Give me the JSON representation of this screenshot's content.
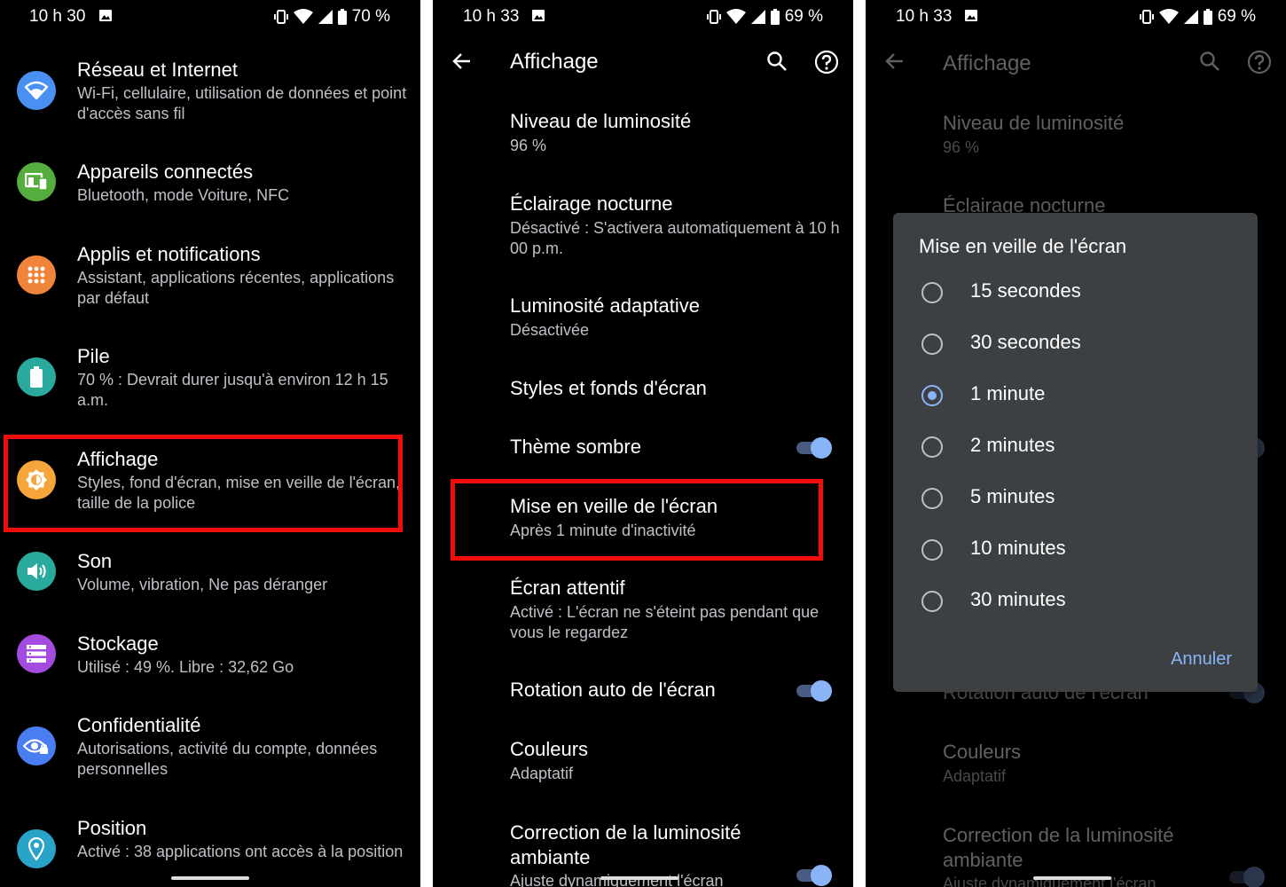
{
  "colors": {
    "highlight": "#f20d0d",
    "accent": "#8ab4f8",
    "dialog_bg": "#3c4043"
  },
  "screen1": {
    "status": {
      "time": "10 h 30",
      "battery": "70 %"
    },
    "items": [
      {
        "icon": "wifi-icon",
        "color": "#4a90f2",
        "title": "Réseau et Internet",
        "subtitle": "Wi-Fi, cellulaire, utilisation de données et point d'accès sans fil"
      },
      {
        "icon": "devices-icon",
        "color": "#55ad3e",
        "title": "Appareils connectés",
        "subtitle": "Bluetooth, mode Voiture, NFC"
      },
      {
        "icon": "apps-icon",
        "color": "#f0843b",
        "title": "Applis et notifications",
        "subtitle": "Assistant, applications récentes, applications par défaut"
      },
      {
        "icon": "battery-icon",
        "color": "#2aa99d",
        "title": "Pile",
        "subtitle": "70 % : Devrait durer jusqu'à environ 12 h 15 a.m."
      },
      {
        "icon": "brightness-icon",
        "color": "#f5a53a",
        "title": "Affichage",
        "subtitle": "Styles, fond d'écran, mise en veille de l'écran, taille de la police"
      },
      {
        "icon": "volume-icon",
        "color": "#2aa99d",
        "title": "Son",
        "subtitle": "Volume, vibration, Ne pas déranger"
      },
      {
        "icon": "storage-icon",
        "color": "#a54ce0",
        "title": "Stockage",
        "subtitle": "Utilisé : 49 %. Libre : 32,62 Go"
      },
      {
        "icon": "privacy-icon",
        "color": "#4a7df2",
        "title": "Confidentialité",
        "subtitle": "Autorisations, activité du compte, données personnelles"
      },
      {
        "icon": "location-icon",
        "color": "#2aa3c9",
        "title": "Position",
        "subtitle": "Activé : 38 applications ont accès à la position"
      }
    ]
  },
  "screen2": {
    "status": {
      "time": "10 h 33",
      "battery": "69 %"
    },
    "title": "Affichage",
    "items": [
      {
        "title": "Niveau de luminosité",
        "subtitle": "96 %"
      },
      {
        "title": "Éclairage nocturne",
        "subtitle": "Désactivé : S'activera automatiquement à 10 h 00 p.m."
      },
      {
        "title": "Luminosité adaptative",
        "subtitle": "Désactivée"
      },
      {
        "title": "Styles et fonds d'écran",
        "subtitle": ""
      },
      {
        "title": "Thème sombre",
        "subtitle": "",
        "toggle": true
      },
      {
        "title": "Mise en veille de l'écran",
        "subtitle": "Après 1 minute d'inactivité"
      },
      {
        "title": "Écran attentif",
        "subtitle": "Activé : L'écran ne s'éteint pas pendant que vous le regardez"
      },
      {
        "title": "Rotation auto de l'écran",
        "subtitle": "",
        "toggle": true
      },
      {
        "title": "Couleurs",
        "subtitle": "Adaptatif"
      },
      {
        "title": "Correction de la luminosité ambiante",
        "subtitle": "Ajuste dynamiquement l'écran",
        "toggle": true
      }
    ]
  },
  "screen3": {
    "status": {
      "time": "10 h 33",
      "battery": "69 %"
    },
    "title": "Affichage",
    "bg_items": [
      {
        "title": "Niveau de luminosité",
        "subtitle": "96 %"
      },
      {
        "title": "Éclairage nocturne",
        "subtitle": ""
      },
      {
        "title": "Rotation auto de l'écran",
        "subtitle": ""
      },
      {
        "title": "Couleurs",
        "subtitle": "Adaptatif"
      },
      {
        "title": "Correction de la luminosité ambiante",
        "subtitle": "Ajuste dynamiquement l'écran"
      }
    ],
    "dialog": {
      "title": "Mise en veille de l'écran",
      "options": [
        "15 secondes",
        "30 secondes",
        "1 minute",
        "2 minutes",
        "5 minutes",
        "10 minutes",
        "30 minutes"
      ],
      "selected": "1 minute",
      "cancel": "Annuler"
    }
  }
}
